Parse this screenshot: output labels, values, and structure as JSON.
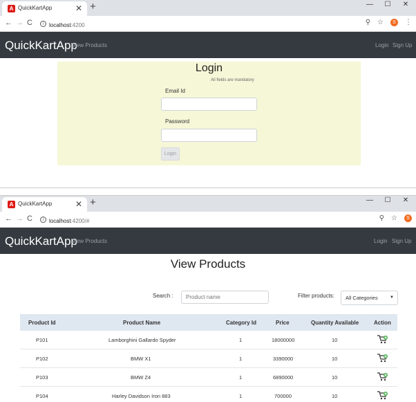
{
  "windows": [
    {
      "tab_title": "QuickKartApp",
      "url_host": "localhost",
      "url_rest": ":4200",
      "profile_initial": "S"
    },
    {
      "tab_title": "QuickKartApp",
      "url_host": "localhost",
      "url_rest": ":4200/#",
      "profile_initial": "S"
    }
  ],
  "navbar": {
    "brand": "QuickKartApp",
    "view_products": "View Products",
    "login": "Login",
    "signup": "Sign Up"
  },
  "login_form": {
    "title": "Login",
    "mandatory_note": "All fields are mandatory",
    "email_label": "Email Id",
    "email_value": "",
    "password_label": "Password",
    "password_value": "",
    "submit_label": "Login"
  },
  "products_page": {
    "title": "View Products",
    "search_label": "Search :",
    "search_placeholder": "Product name",
    "filter_label": "Filter products:",
    "filter_selected": "All Categories",
    "columns": [
      "Product Id",
      "Product Name",
      "Category Id",
      "Price",
      "Quantity Available",
      "Action"
    ],
    "rows": [
      {
        "id": "P101",
        "name": "Lamborghini Gallardo Spyder",
        "category": "1",
        "price": "18000000",
        "qty": "10"
      },
      {
        "id": "P102",
        "name": "BMW X1",
        "category": "1",
        "price": "3390000",
        "qty": "10"
      },
      {
        "id": "P103",
        "name": "BMW Z4",
        "category": "1",
        "price": "6890000",
        "qty": "10"
      },
      {
        "id": "P104",
        "name": "Harley Davidson Iron 883",
        "category": "1",
        "price": "700000",
        "qty": "10"
      }
    ]
  },
  "colors": {
    "navbar_bg": "#343a40",
    "login_card_bg": "#f6f7d7",
    "table_header_bg": "#dfe7f1",
    "favicon": "#dd1b16",
    "profile": "#f26b21"
  },
  "icons": {
    "back": "arrow-left",
    "forward": "arrow-right",
    "reload": "reload",
    "zoom": "magnifier",
    "bookmark": "star",
    "menu": "kebab",
    "add_to_cart": "cart-plus"
  }
}
